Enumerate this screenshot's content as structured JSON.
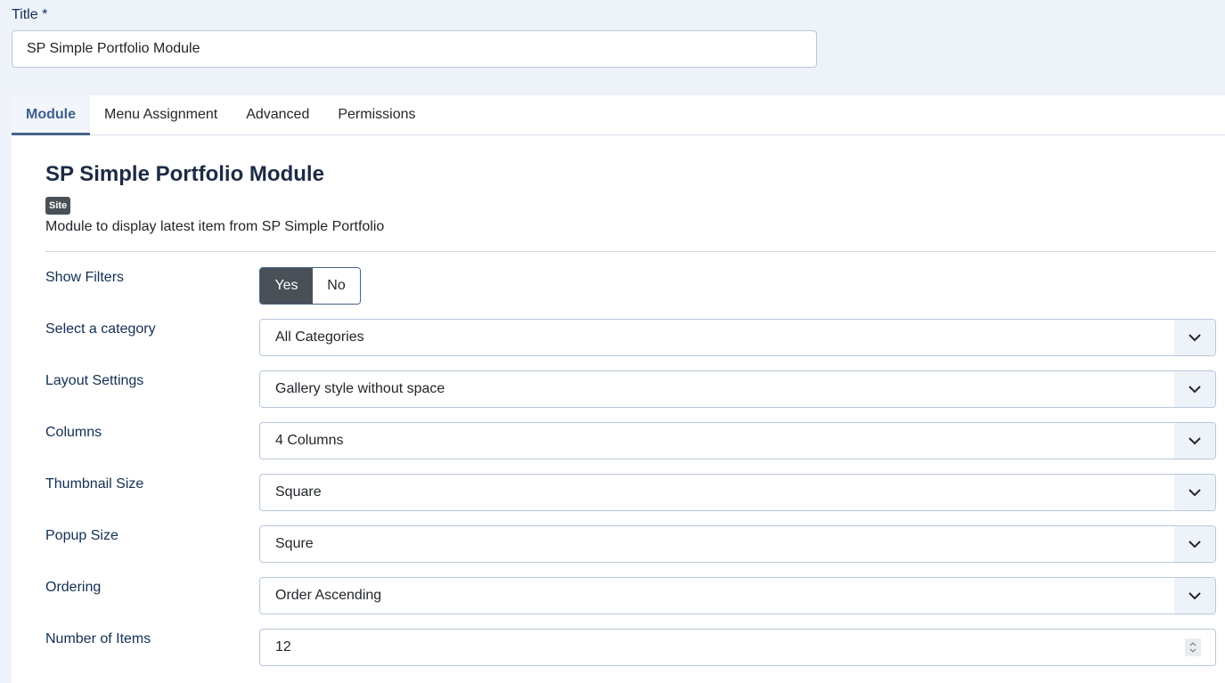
{
  "title_field": {
    "label": "Title *",
    "value": "SP Simple Portfolio Module"
  },
  "tabs": [
    {
      "label": "Module",
      "active": true
    },
    {
      "label": "Menu Assignment",
      "active": false
    },
    {
      "label": "Advanced",
      "active": false
    },
    {
      "label": "Permissions",
      "active": false
    }
  ],
  "module": {
    "heading": "SP Simple Portfolio Module",
    "badge": "Site",
    "description": "Module to display latest item from SP Simple Portfolio"
  },
  "fields": {
    "show_filters": {
      "label": "Show Filters",
      "options": [
        "Yes",
        "No"
      ],
      "selected": "Yes"
    },
    "category": {
      "label": "Select a category",
      "value": "All Categories",
      "icon": "chevron-down-icon"
    },
    "layout": {
      "label": "Layout Settings",
      "value": "Gallery style without space",
      "icon": "chevron-down-icon"
    },
    "columns": {
      "label": "Columns",
      "value": "4 Columns",
      "icon": "chevron-down-icon"
    },
    "thumbnail_size": {
      "label": "Thumbnail Size",
      "value": "Square",
      "icon": "chevron-down-icon"
    },
    "popup_size": {
      "label": "Popup Size",
      "value": "Squre",
      "icon": "chevron-down-icon"
    },
    "ordering": {
      "label": "Ordering",
      "value": "Order Ascending",
      "icon": "chevron-down-icon"
    },
    "number_of_items": {
      "label": "Number of Items",
      "value": "12",
      "icon": "spinner-icon"
    }
  }
}
